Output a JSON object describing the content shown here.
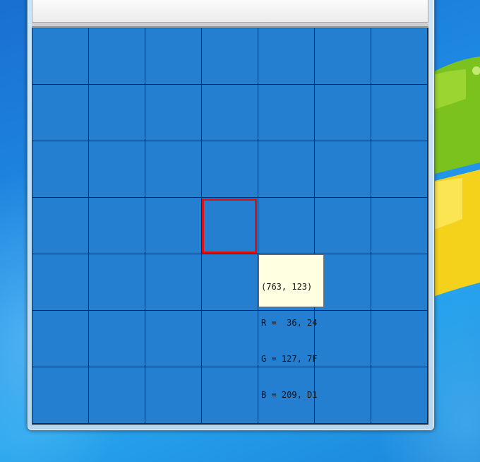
{
  "desktop": {
    "wallpaper": "windows-7-default",
    "colors": {
      "accent_blue": "#1e8ee6",
      "logo_green": "#7cc21f",
      "logo_yellow": "#f4d21c"
    }
  },
  "window": {
    "colors": {
      "frame": "#b6d6ef",
      "toolbar": "#ececec"
    }
  },
  "grid": {
    "rows": 7,
    "columns": 7,
    "cell_color": "#247fd1",
    "line_color": "#232323",
    "selected_cell": {
      "row": 4,
      "column": 4,
      "border_color": "#e01010"
    }
  },
  "pixel_tooltip": {
    "coords": "(763, 123)",
    "r_line": "R =  36, 24",
    "g_line": "G = 127, 7F",
    "b_line": "B = 209, D1"
  }
}
